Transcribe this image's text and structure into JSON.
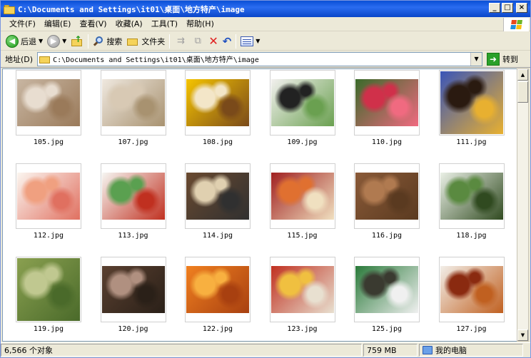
{
  "window": {
    "title": "C:\\Documents and Settings\\it01\\桌面\\地方特产\\image",
    "controls": {
      "minimize": "_",
      "maximize": "□",
      "close": "×"
    }
  },
  "menu": [
    "文件(F)",
    "编辑(E)",
    "查看(V)",
    "收藏(A)",
    "工具(T)",
    "帮助(H)"
  ],
  "toolbar": {
    "back": "后退",
    "search": "搜索",
    "folders": "文件夹"
  },
  "address": {
    "label": "地址(D)",
    "value": "C:\\Documents and Settings\\it01\\桌面\\地方特产\\image",
    "go": "转到"
  },
  "files": [
    {
      "name": "105.jpg",
      "colors": [
        "#c8b6a2",
        "#e8ddd0",
        "#9a7a5a"
      ]
    },
    {
      "name": "107.jpg",
      "colors": [
        "#efe8df",
        "#d8c9b4",
        "#a89270"
      ]
    },
    {
      "name": "108.jpg",
      "colors": [
        "#f5c400",
        "#f3e6c8",
        "#7a4a1a"
      ]
    },
    {
      "name": "109.jpg",
      "colors": [
        "#f2f0ee",
        "#222222",
        "#6aa050"
      ]
    },
    {
      "name": "110.jpg",
      "colors": [
        "#3a6a2a",
        "#d0304a",
        "#f06a80"
      ]
    },
    {
      "name": "111.jpg",
      "colors": [
        "#3a55b8",
        "#2a1a10",
        "#e8b030"
      ]
    },
    {
      "name": "112.jpg",
      "colors": [
        "#fbf6f0",
        "#f0a080",
        "#e07060"
      ]
    },
    {
      "name": "113.jpg",
      "colors": [
        "#f6f6f2",
        "#5aa050",
        "#c03020"
      ]
    },
    {
      "name": "114.jpg",
      "colors": [
        "#6a4a30",
        "#e0d0b0",
        "#303030"
      ]
    },
    {
      "name": "115.jpg",
      "colors": [
        "#a02020",
        "#e07030",
        "#f0e0c0"
      ]
    },
    {
      "name": "116.jpg",
      "colors": [
        "#8a5a38",
        "#b07a50",
        "#5a3a20"
      ]
    },
    {
      "name": "118.jpg",
      "colors": [
        "#eaf0e6",
        "#5a8a40",
        "#304a20"
      ]
    },
    {
      "name": "119.jpg",
      "colors": [
        "#8aa050",
        "#c0c890",
        "#4a6a2a"
      ]
    },
    {
      "name": "120.jpg",
      "colors": [
        "#5a4030",
        "#b09080",
        "#2a2018"
      ]
    },
    {
      "name": "122.jpg",
      "colors": [
        "#f08020",
        "#f8b040",
        "#a84010"
      ]
    },
    {
      "name": "123.jpg",
      "colors": [
        "#c03020",
        "#f0c040",
        "#e8e0d0"
      ]
    },
    {
      "name": "125.jpg",
      "colors": [
        "#2a7a3a",
        "#3a3a30",
        "#f0f0f0"
      ]
    },
    {
      "name": "127.jpg",
      "colors": [
        "#f2eee8",
        "#8a2a10",
        "#c06020"
      ]
    }
  ],
  "status": {
    "count": "6,566 个对象",
    "size": "759 MB",
    "zone": "我的电脑"
  }
}
